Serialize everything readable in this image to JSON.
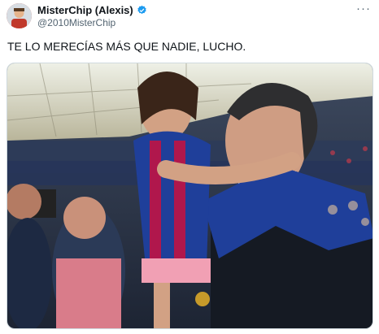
{
  "author": {
    "display_name": "MisterChip (Alexis)",
    "handle": "@2010MisterChip",
    "verified_icon": "verified-badge-icon",
    "avatar_icon": "avatar"
  },
  "tweet": {
    "text": "TE LO MERECÍAS MÁS QUE NADIE, LUCHO."
  },
  "menu": {
    "more_label": "···"
  },
  "colors": {
    "verified_blue": "#1d9bf0",
    "muted_text": "#536471",
    "jersey_blue": "#1f3f9a",
    "jersey_red": "#b0174c"
  }
}
